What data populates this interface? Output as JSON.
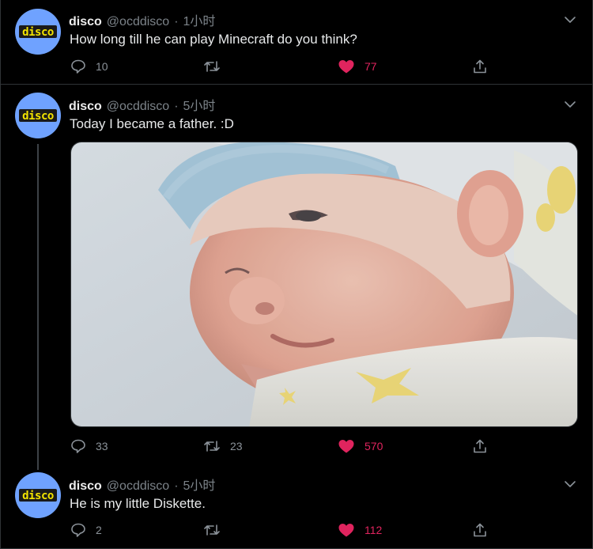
{
  "tweets": [
    {
      "name": "disco",
      "handle": "@ocddisco",
      "dot": "·",
      "time": "1小时",
      "text": "How long till he can play Minecraft do you think?",
      "replies": "10",
      "retweets": "",
      "likes": "77"
    },
    {
      "name": "disco",
      "handle": "@ocddisco",
      "dot": "·",
      "time": "5小时",
      "text": "Today I became a father.  :D",
      "replies": "33",
      "retweets": "23",
      "likes": "570"
    },
    {
      "name": "disco",
      "handle": "@ocddisco",
      "dot": "·",
      "time": "5小时",
      "text": "He is my little Diskette.",
      "replies": "2",
      "retweets": "",
      "likes": "112"
    }
  ],
  "avatar_text": "disco",
  "colors": {
    "background": "#000000",
    "text": "#e7e9ea",
    "muted": "#7c8389",
    "like": "#e0245e",
    "avatar": "#6fa2ff",
    "avatar_logo": "#f2e300"
  },
  "icons": [
    "reply-icon",
    "retweet-icon",
    "heart-icon",
    "share-icon",
    "chevron-down-icon"
  ]
}
